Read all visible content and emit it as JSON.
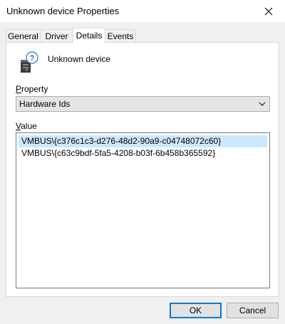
{
  "window": {
    "title": "Unknown device Properties"
  },
  "tabs": [
    {
      "label": "General",
      "active": false
    },
    {
      "label": "Driver",
      "active": false
    },
    {
      "label": "Details",
      "active": true
    },
    {
      "label": "Events",
      "active": false
    }
  ],
  "device": {
    "name": "Unknown device",
    "icon": "unknown-device-icon"
  },
  "property": {
    "label_prefix": "P",
    "label_rest": "roperty",
    "selected_value": "Hardware Ids"
  },
  "value": {
    "label_prefix": "V",
    "label_rest": "alue",
    "items": [
      {
        "text": "VMBUS\\{c376c1c3-d276-48d2-90a9-c04748072c60}",
        "selected": true
      },
      {
        "text": "VMBUS\\{c63c9bdf-5fa5-4208-b03f-6b458b365592}",
        "selected": false
      }
    ]
  },
  "buttons": {
    "ok": "OK",
    "cancel": "Cancel"
  },
  "colors": {
    "selection": "#cce8ff",
    "default_button_border": "#0078d7"
  }
}
